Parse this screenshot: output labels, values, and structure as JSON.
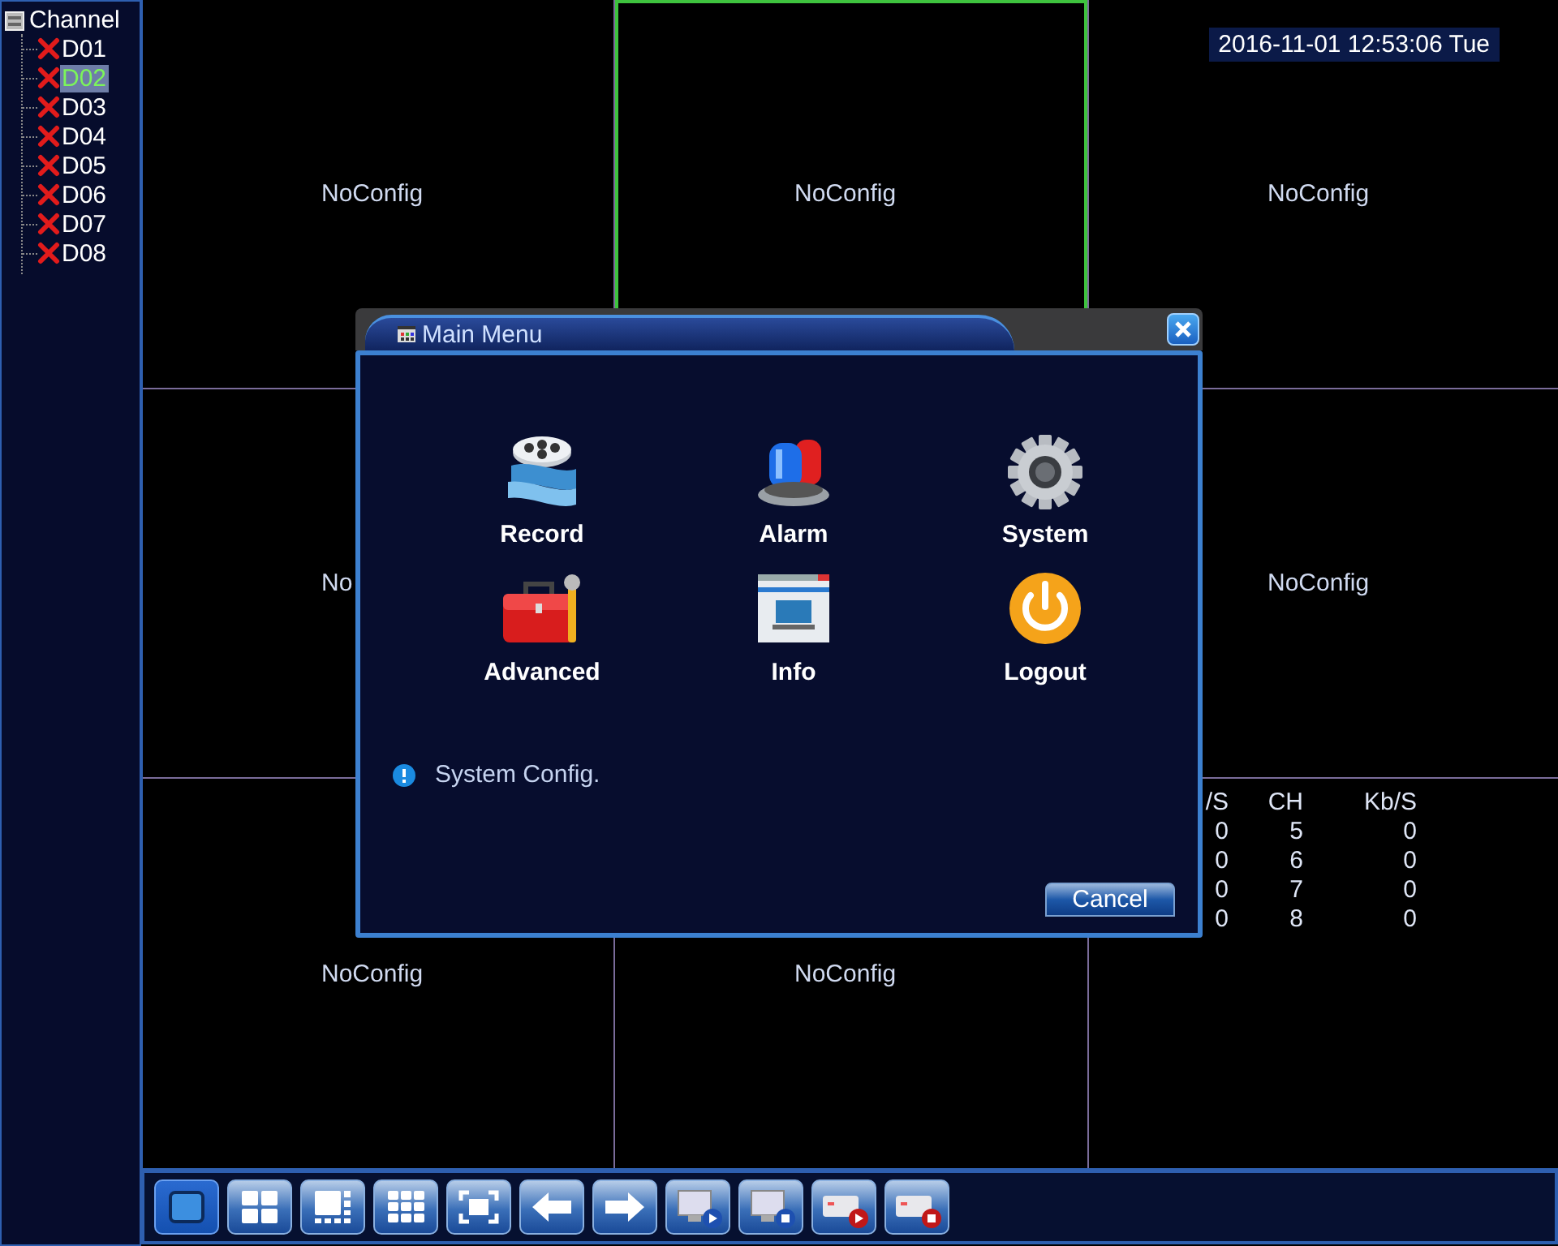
{
  "sidebar": {
    "title": "Channel",
    "channels": [
      {
        "label": "D01",
        "selected": false
      },
      {
        "label": "D02",
        "selected": true
      },
      {
        "label": "D03",
        "selected": false
      },
      {
        "label": "D04",
        "selected": false
      },
      {
        "label": "D05",
        "selected": false
      },
      {
        "label": "D06",
        "selected": false
      },
      {
        "label": "D07",
        "selected": false
      },
      {
        "label": "D08",
        "selected": false
      }
    ]
  },
  "grid": {
    "cells": [
      {
        "label": "NoConfig",
        "selected": false
      },
      {
        "label": "NoConfig",
        "selected": true
      },
      {
        "label": "NoConfig",
        "selected": false,
        "datetime": "2016-11-01 12:53:06 Tue"
      },
      {
        "label": "No",
        "selected": false
      },
      {},
      {
        "label": "NoConfig",
        "selected": false
      },
      {
        "label": "NoConfig",
        "selected": false
      },
      {
        "label": "NoConfig",
        "selected": false
      },
      {
        "selected": false,
        "stats": {
          "columns": [
            "/S",
            "CH",
            "Kb/S"
          ],
          "rows": [
            [
              "0",
              "5",
              "0"
            ],
            [
              "0",
              "6",
              "0"
            ],
            [
              "0",
              "7",
              "0"
            ],
            [
              "0",
              "8",
              "0"
            ]
          ]
        }
      }
    ]
  },
  "main_menu": {
    "title": "Main Menu",
    "items": [
      {
        "kind": "record",
        "label": "Record"
      },
      {
        "kind": "alarm",
        "label": "Alarm"
      },
      {
        "kind": "system",
        "label": "System"
      },
      {
        "kind": "advanced",
        "label": "Advanced"
      },
      {
        "kind": "info",
        "label": "Info"
      },
      {
        "kind": "logout",
        "label": "Logout"
      }
    ],
    "hint": "System Config.",
    "cancel": "Cancel"
  },
  "toolbar": [
    {
      "kind": "single",
      "selected": true
    },
    {
      "kind": "quad",
      "selected": false
    },
    {
      "kind": "eight",
      "selected": false
    },
    {
      "kind": "nine",
      "selected": false
    },
    {
      "kind": "fullscreen",
      "selected": false
    },
    {
      "kind": "prev",
      "selected": false
    },
    {
      "kind": "next",
      "selected": false
    },
    {
      "kind": "monitor-play",
      "selected": false
    },
    {
      "kind": "monitor-stop",
      "selected": false
    },
    {
      "kind": "record-play",
      "selected": false
    },
    {
      "kind": "record-stop",
      "selected": false
    }
  ]
}
